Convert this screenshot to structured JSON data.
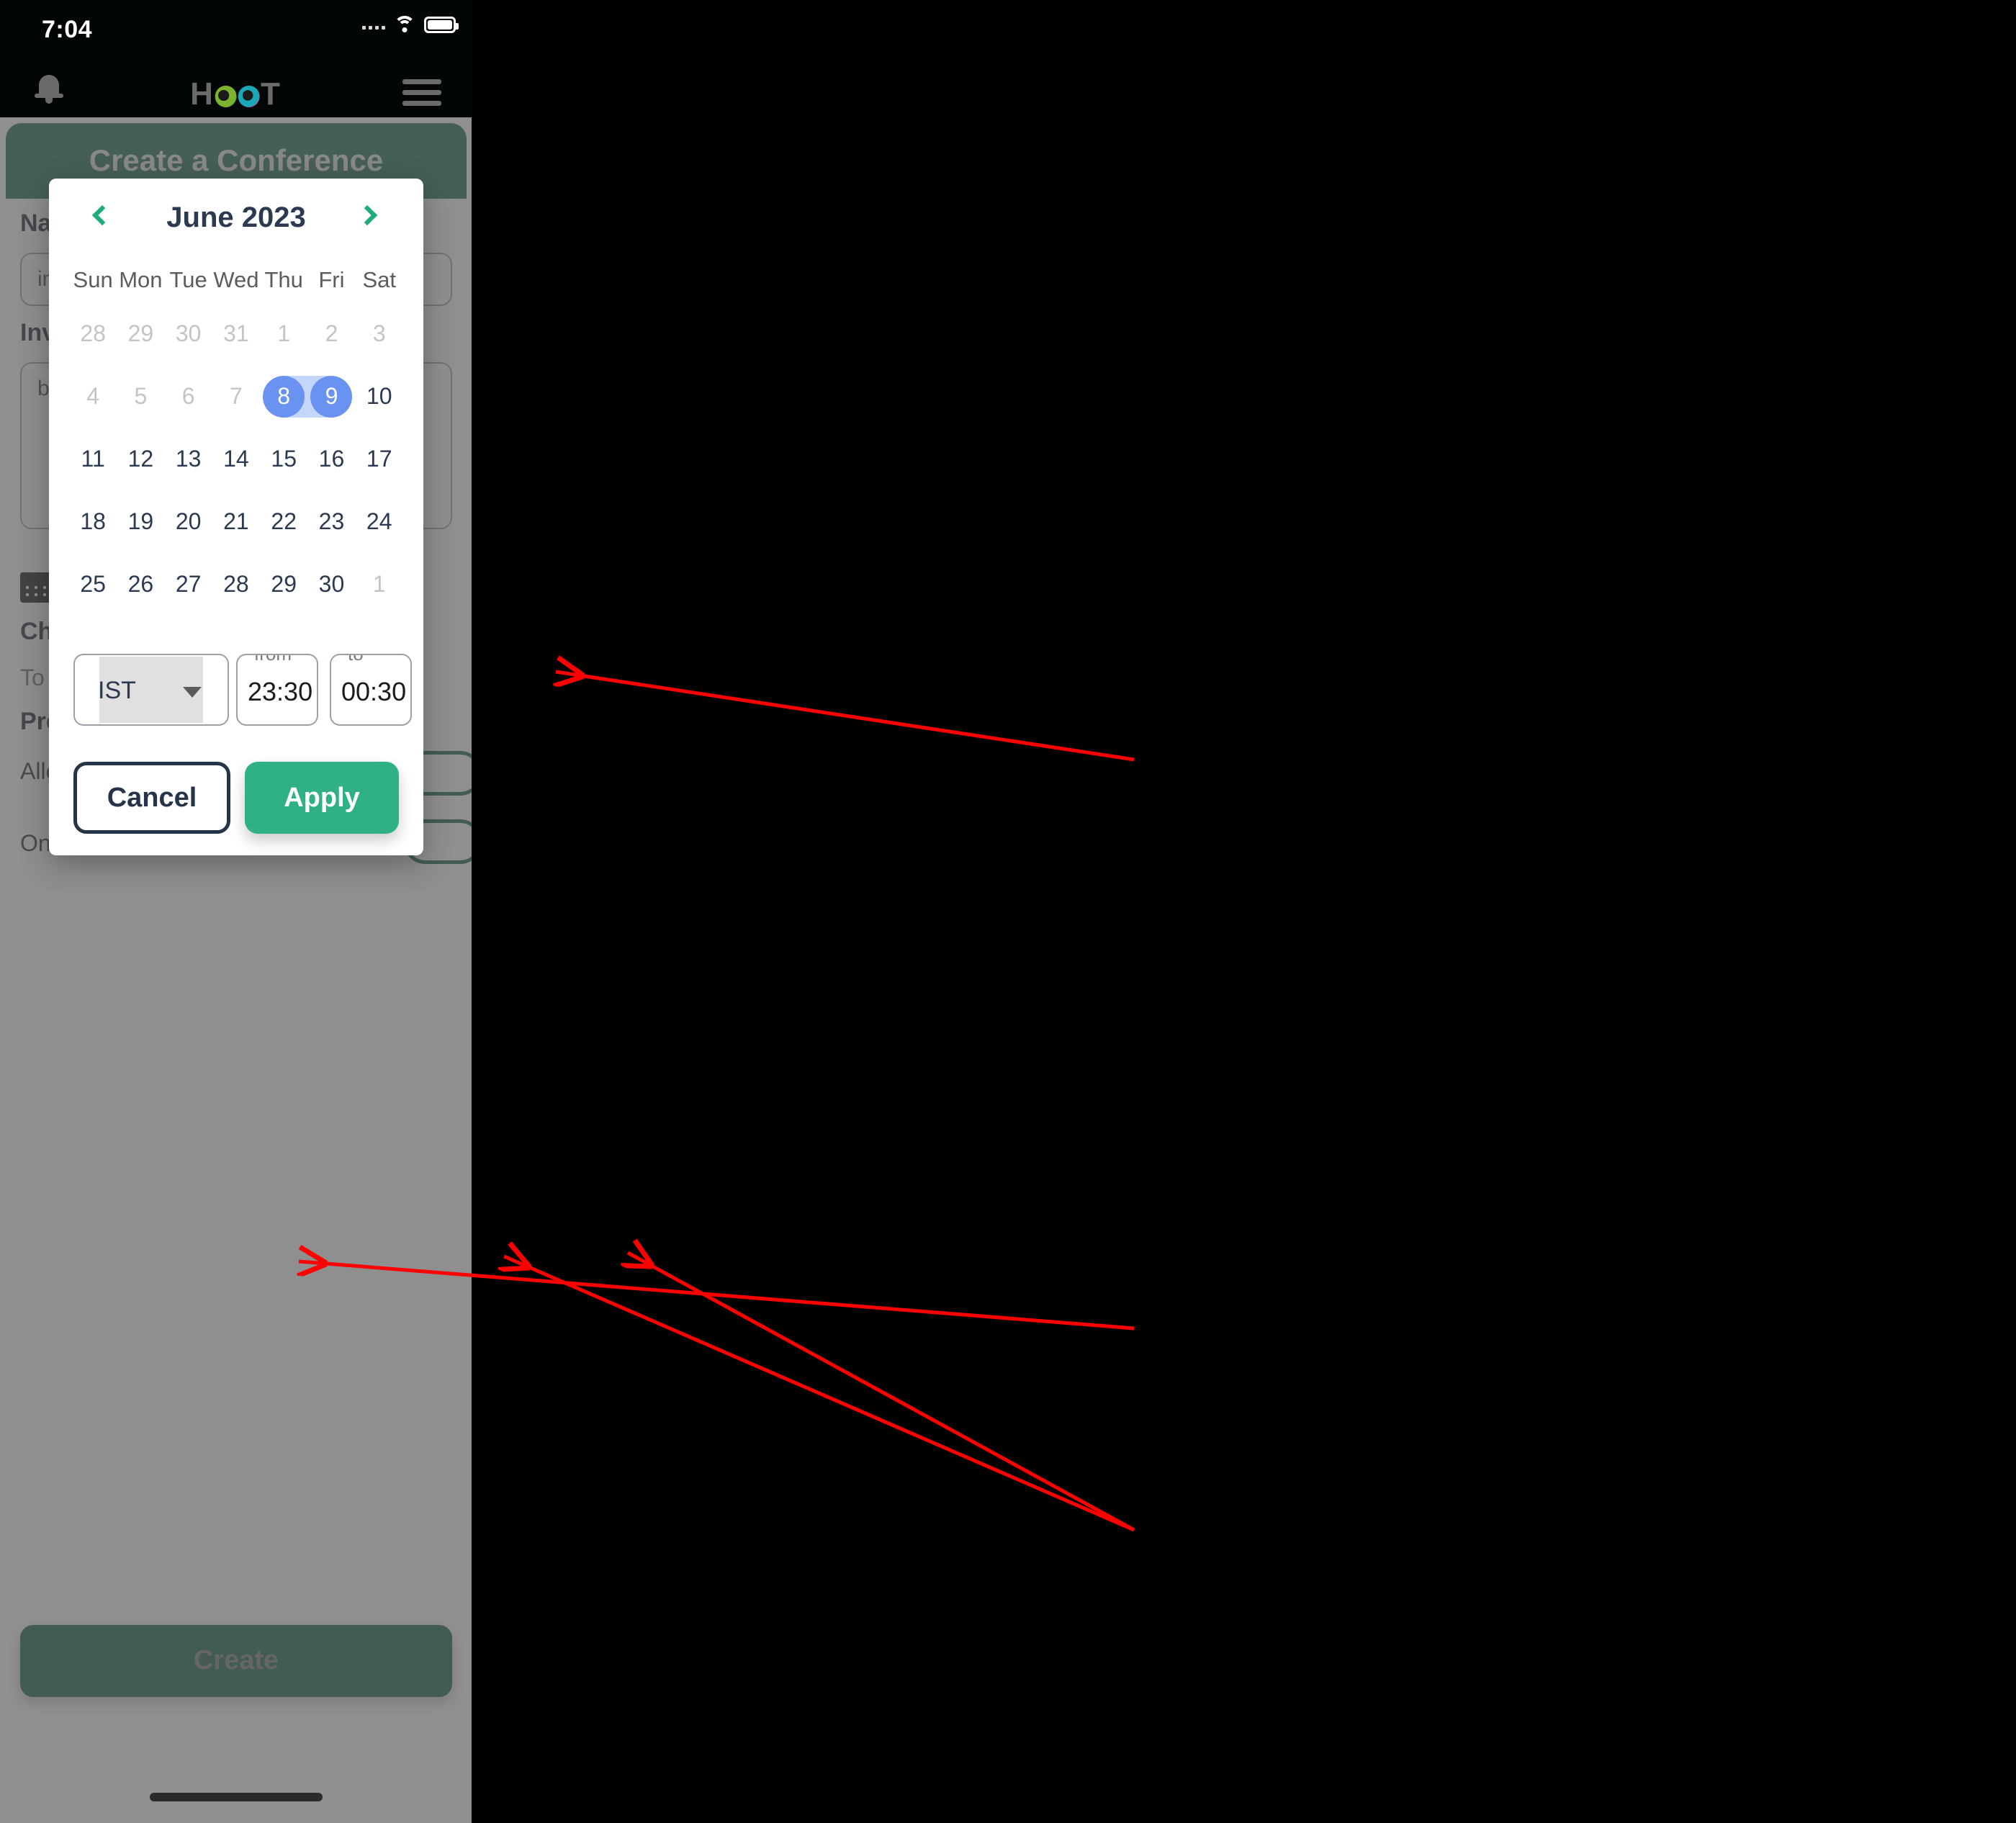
{
  "status_bar": {
    "time": "7:04",
    "icons": [
      "signal-dots-icon",
      "wifi-icon",
      "battery-icon"
    ]
  },
  "app_header": {
    "notification_icon": "bell-icon",
    "brand": {
      "prefix": "H",
      "suffix": "T",
      "eyes_icon": "owl-eyes-icon"
    },
    "menu_icon": "hamburger-menu-icon"
  },
  "page_behind": {
    "banner_title": "Create a Conference",
    "labels": {
      "name": "Na",
      "invitees": "Inv",
      "choose": "Ch",
      "to": "To",
      "prefs": "Pre",
      "allow": "Allo",
      "only": "Onl"
    },
    "inputs": {
      "name_value": "inv",
      "invitees_value": "bi"
    },
    "calendar_icon": "calendar-icon",
    "create_button": "Create"
  },
  "modal": {
    "calendar": {
      "title": "June 2023",
      "prev_icon": "chevron-left-icon",
      "next_icon": "chevron-right-icon",
      "weekdays": [
        "Sun",
        "Mon",
        "Tue",
        "Wed",
        "Thu",
        "Fri",
        "Sat"
      ],
      "weeks": [
        [
          {
            "d": "28",
            "state": "muted"
          },
          {
            "d": "29",
            "state": "muted"
          },
          {
            "d": "30",
            "state": "muted"
          },
          {
            "d": "31",
            "state": "muted"
          },
          {
            "d": "1",
            "state": "muted"
          },
          {
            "d": "2",
            "state": "muted"
          },
          {
            "d": "3",
            "state": "muted"
          }
        ],
        [
          {
            "d": "4",
            "state": "muted"
          },
          {
            "d": "5",
            "state": "muted"
          },
          {
            "d": "6",
            "state": "muted"
          },
          {
            "d": "7",
            "state": "muted"
          },
          {
            "d": "8",
            "state": "selected-start"
          },
          {
            "d": "9",
            "state": "selected-end"
          },
          {
            "d": "10",
            "state": "normal"
          }
        ],
        [
          {
            "d": "11",
            "state": "normal"
          },
          {
            "d": "12",
            "state": "normal"
          },
          {
            "d": "13",
            "state": "normal"
          },
          {
            "d": "14",
            "state": "normal"
          },
          {
            "d": "15",
            "state": "normal"
          },
          {
            "d": "16",
            "state": "normal"
          },
          {
            "d": "17",
            "state": "normal"
          }
        ],
        [
          {
            "d": "18",
            "state": "normal"
          },
          {
            "d": "19",
            "state": "normal"
          },
          {
            "d": "20",
            "state": "normal"
          },
          {
            "d": "21",
            "state": "normal"
          },
          {
            "d": "22",
            "state": "normal"
          },
          {
            "d": "23",
            "state": "normal"
          },
          {
            "d": "24",
            "state": "normal"
          }
        ],
        [
          {
            "d": "25",
            "state": "normal"
          },
          {
            "d": "26",
            "state": "normal"
          },
          {
            "d": "27",
            "state": "normal"
          },
          {
            "d": "28",
            "state": "normal"
          },
          {
            "d": "29",
            "state": "normal"
          },
          {
            "d": "30",
            "state": "normal"
          },
          {
            "d": "1",
            "state": "muted"
          }
        ]
      ],
      "selected_range": [
        "8",
        "9"
      ]
    },
    "timezone": {
      "value": "IST",
      "caret_icon": "chevron-down-icon"
    },
    "time_from": {
      "legend": "from",
      "value": "23:30"
    },
    "time_to": {
      "legend": "to",
      "value": "00:30"
    },
    "buttons": {
      "cancel": "Cancel",
      "apply": "Apply"
    }
  },
  "colors": {
    "brand_green": "#1d6b4f",
    "accent_green": "#2fb185",
    "chevron_green": "#1fab7a",
    "selected_blue": "#6a92f0",
    "range_blue": "#c4d7fb",
    "text_navy": "#2b3a50",
    "muted_gray": "#c4c4c4",
    "annotation_red": "#ff0000"
  }
}
